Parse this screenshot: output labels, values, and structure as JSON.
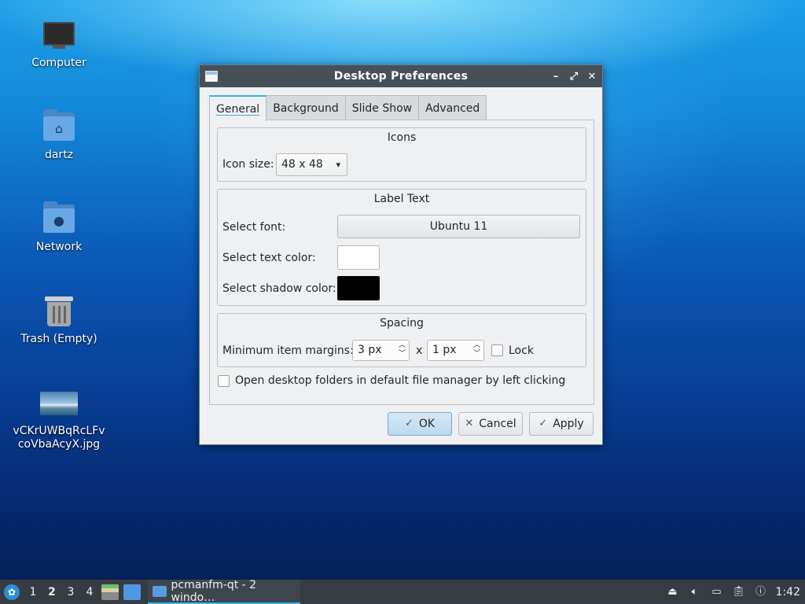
{
  "desktop": {
    "icons": [
      {
        "label": "Computer",
        "icon": "computer-icon"
      },
      {
        "label": "dartz",
        "icon": "home-folder-icon"
      },
      {
        "label": "Network",
        "icon": "network-folder-icon"
      },
      {
        "label": "Trash (Empty)",
        "icon": "trash-icon"
      },
      {
        "label_line1": "vCKrUWBqRcLFv",
        "label_line2": "coVbaAcyX.jpg",
        "icon": "image-file-icon"
      }
    ]
  },
  "dialog": {
    "title": "Desktop Preferences",
    "tabs": [
      "General",
      "Background",
      "Slide Show",
      "Advanced"
    ],
    "active_tab": "General",
    "icons_group": {
      "title": "Icons",
      "icon_size_label": "Icon size:",
      "icon_size_value": "48 x 48"
    },
    "label_text_group": {
      "title": "Label Text",
      "font_label": "Select font:",
      "font_value": "Ubuntu 11",
      "text_color_label": "Select text color:",
      "text_color": "#ffffff",
      "shadow_color_label": "Select shadow color:",
      "shadow_color": "#000000"
    },
    "spacing_group": {
      "title": "Spacing",
      "margins_label": "Minimum item margins:",
      "margin_x": "3 px",
      "separator": "x",
      "margin_y": "1 px",
      "lock_label": "Lock",
      "lock_checked": false
    },
    "open_folders_label": "Open desktop folders in default file manager by left clicking",
    "open_folders_checked": false,
    "buttons": {
      "ok": "OK",
      "cancel": "Cancel",
      "apply": "Apply"
    }
  },
  "taskbar": {
    "workspaces": [
      "1",
      "2",
      "3",
      "4"
    ],
    "current_workspace": "2",
    "task_label": "pcmanfm-qt - 2 windo…",
    "clock": "1:42"
  },
  "colors": {
    "accent": "#3daee9",
    "titlebar": "#475057",
    "taskbar": "#363c42"
  }
}
